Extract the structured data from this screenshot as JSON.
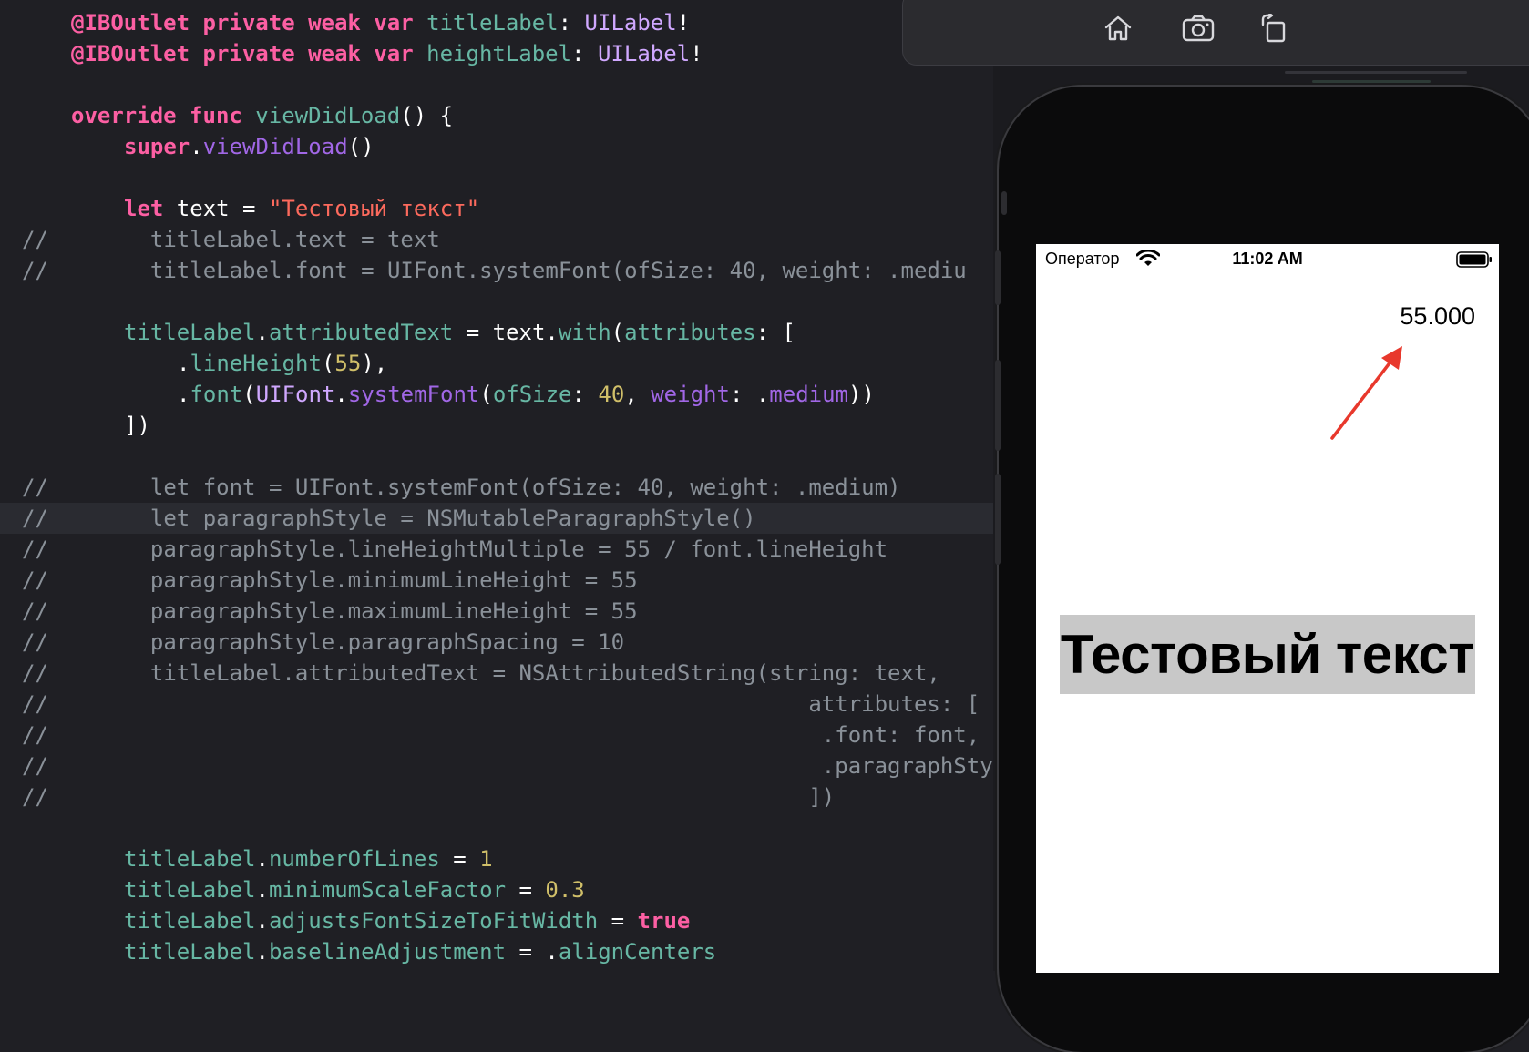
{
  "editor": {
    "lines": [
      {
        "indent": 1,
        "commented": false,
        "tokens": [
          [
            "kw",
            "@IBOutlet private weak var "
          ],
          [
            "prop",
            "titleLabel"
          ],
          [
            "pl",
            ": "
          ],
          [
            "type",
            "UILabel"
          ],
          [
            "pl",
            "!"
          ]
        ]
      },
      {
        "indent": 1,
        "commented": false,
        "tokens": [
          [
            "kw",
            "@IBOutlet private weak var "
          ],
          [
            "prop",
            "heightLabel"
          ],
          [
            "pl",
            ": "
          ],
          [
            "type",
            "UILabel"
          ],
          [
            "pl",
            "!"
          ]
        ]
      },
      {
        "blank": true
      },
      {
        "indent": 1,
        "commented": false,
        "tokens": [
          [
            "kw",
            "override func "
          ],
          [
            "prop",
            "viewDidLoad"
          ],
          [
            "pl",
            "() {"
          ]
        ]
      },
      {
        "indent": 2,
        "commented": false,
        "tokens": [
          [
            "kw",
            "super"
          ],
          [
            "pl",
            "."
          ],
          [
            "fn",
            "viewDidLoad"
          ],
          [
            "pl",
            "()"
          ]
        ]
      },
      {
        "blank": true
      },
      {
        "indent": 2,
        "commented": false,
        "tokens": [
          [
            "kw",
            "let "
          ],
          [
            "pl",
            "text = "
          ],
          [
            "str",
            "\"Тестовый текст\""
          ]
        ]
      },
      {
        "indent": 2,
        "commented": true,
        "tokens": [
          [
            "cm",
            "  titleLabel.text = text"
          ]
        ]
      },
      {
        "indent": 2,
        "commented": true,
        "tokens": [
          [
            "cm",
            "  titleLabel.font = UIFont.systemFont(ofSize: 40, weight: .mediu"
          ]
        ]
      },
      {
        "blank": true
      },
      {
        "indent": 2,
        "commented": false,
        "tokens": [
          [
            "prop",
            "titleLabel"
          ],
          [
            "pl",
            "."
          ],
          [
            "prop",
            "attributedText"
          ],
          [
            "pl",
            " = text."
          ],
          [
            "prop",
            "with"
          ],
          [
            "pl",
            "("
          ],
          [
            "prop",
            "attributes"
          ],
          [
            "pl",
            ": ["
          ]
        ]
      },
      {
        "indent": 3,
        "commented": false,
        "tokens": [
          [
            "pl",
            "."
          ],
          [
            "prop",
            "lineHeight"
          ],
          [
            "pl",
            "("
          ],
          [
            "num",
            "55"
          ],
          [
            "pl",
            "),"
          ]
        ]
      },
      {
        "indent": 3,
        "commented": false,
        "tokens": [
          [
            "pl",
            "."
          ],
          [
            "prop",
            "font"
          ],
          [
            "pl",
            "("
          ],
          [
            "type",
            "UIFont"
          ],
          [
            "pl",
            "."
          ],
          [
            "fn",
            "systemFont"
          ],
          [
            "pl",
            "("
          ],
          [
            "prop",
            "ofSize"
          ],
          [
            "pl",
            ": "
          ],
          [
            "num",
            "40"
          ],
          [
            "pl",
            ", "
          ],
          [
            "fn",
            "weight"
          ],
          [
            "pl",
            ": ."
          ],
          [
            "fn",
            "medium"
          ],
          [
            "pl",
            "))"
          ]
        ]
      },
      {
        "indent": 2,
        "commented": false,
        "tokens": [
          [
            "pl",
            "])"
          ]
        ]
      },
      {
        "blank": true
      },
      {
        "indent": 2,
        "commented": true,
        "tokens": [
          [
            "cm",
            "  let font = UIFont.systemFont(ofSize: 40, weight: .medium)"
          ]
        ]
      },
      {
        "indent": 2,
        "commented": true,
        "current": true,
        "tokens": [
          [
            "cm",
            "  let paragraphStyle = NSMutableParagraphStyle()"
          ]
        ]
      },
      {
        "indent": 2,
        "commented": true,
        "tokens": [
          [
            "cm",
            "  paragraphStyle.lineHeightMultiple = 55 / font.lineHeight"
          ]
        ]
      },
      {
        "indent": 2,
        "commented": true,
        "tokens": [
          [
            "cm",
            "  paragraphStyle.minimumLineHeight = 55"
          ]
        ]
      },
      {
        "indent": 2,
        "commented": true,
        "tokens": [
          [
            "cm",
            "  paragraphStyle.maximumLineHeight = 55"
          ]
        ]
      },
      {
        "indent": 2,
        "commented": true,
        "tokens": [
          [
            "cm",
            "  paragraphStyle.paragraphSpacing = 10"
          ]
        ]
      },
      {
        "indent": 2,
        "commented": true,
        "tokens": [
          [
            "cm",
            "  titleLabel.attributedText = NSAttributedString(string: text,"
          ]
        ]
      },
      {
        "indent": 2,
        "commented": true,
        "tokens": [
          [
            "cm",
            "                                                    attributes: ["
          ]
        ]
      },
      {
        "indent": 2,
        "commented": true,
        "tokens": [
          [
            "cm",
            "                                                     .font: font,"
          ]
        ]
      },
      {
        "indent": 2,
        "commented": true,
        "tokens": [
          [
            "cm",
            "                                                     .paragraphStyl"
          ]
        ]
      },
      {
        "indent": 2,
        "commented": true,
        "tokens": [
          [
            "cm",
            "                                                    ])"
          ]
        ]
      },
      {
        "blank": true
      },
      {
        "indent": 2,
        "commented": false,
        "tokens": [
          [
            "prop",
            "titleLabel"
          ],
          [
            "pl",
            "."
          ],
          [
            "prop",
            "numberOfLines"
          ],
          [
            "pl",
            " = "
          ],
          [
            "num",
            "1"
          ]
        ]
      },
      {
        "indent": 2,
        "commented": false,
        "tokens": [
          [
            "prop",
            "titleLabel"
          ],
          [
            "pl",
            "."
          ],
          [
            "prop",
            "minimumScaleFactor"
          ],
          [
            "pl",
            " = "
          ],
          [
            "num",
            "0.3"
          ]
        ]
      },
      {
        "indent": 2,
        "commented": false,
        "tokens": [
          [
            "prop",
            "titleLabel"
          ],
          [
            "pl",
            "."
          ],
          [
            "prop",
            "adjustsFontSizeToFitWidth"
          ],
          [
            "pl",
            " = "
          ],
          [
            "kw",
            "true"
          ]
        ]
      },
      {
        "indent": 2,
        "commented": false,
        "tokens": [
          [
            "prop",
            "titleLabel"
          ],
          [
            "pl",
            "."
          ],
          [
            "prop",
            "baselineAdjustment"
          ],
          [
            "pl",
            " = ."
          ],
          [
            "prop",
            "alignCenters"
          ]
        ]
      }
    ],
    "comment_marker": "//"
  },
  "simulator": {
    "toolbar": {
      "home_icon": "home-icon",
      "screenshot_icon": "camera-icon",
      "rotate_icon": "rotate-icon"
    },
    "status_bar": {
      "carrier": "Оператор",
      "time": "11:02 AM",
      "wifi_icon": "wifi-icon",
      "battery_icon": "battery-icon"
    },
    "height_label": "55.000",
    "title_label": "Тестовый текст",
    "annotation": {
      "icon": "red-arrow-icon",
      "color": "#e8382c"
    },
    "title_highlight_color": "#c8c8c8"
  }
}
